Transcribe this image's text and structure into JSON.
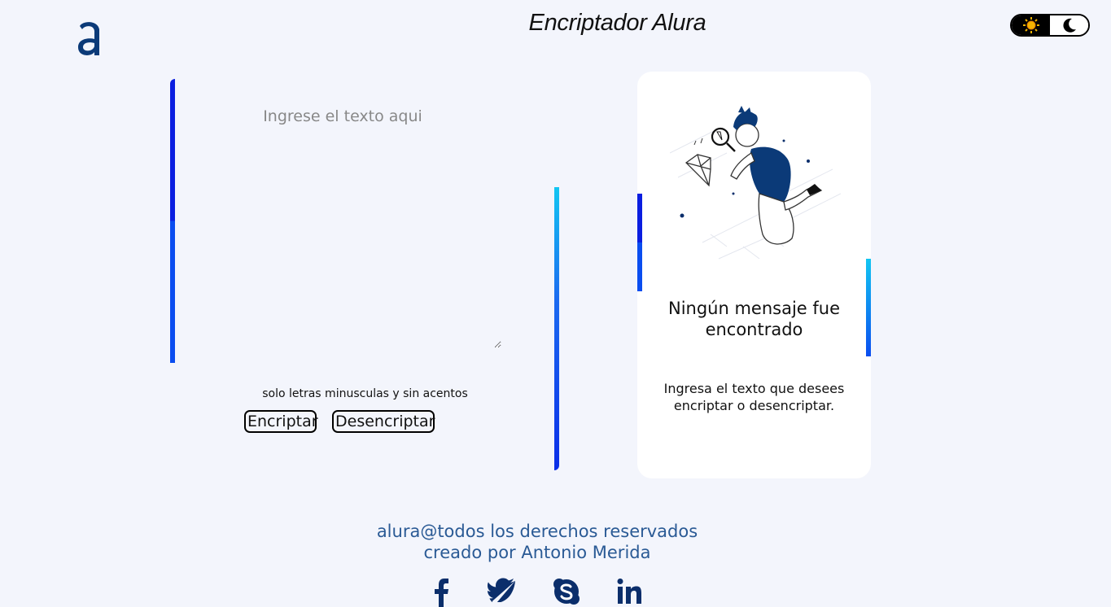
{
  "header": {
    "logo_icon": "alura-logo-icon",
    "title": "Encriptador Alura",
    "theme_toggle": {
      "light_icon": "sun-icon",
      "dark_icon": "moon-icon"
    }
  },
  "input": {
    "placeholder": "Ingrese el texto aqui",
    "value": ""
  },
  "hint": "solo letras minusculas y sin acentos",
  "buttons": {
    "encrypt": "Encriptar",
    "decrypt": "Desencriptar"
  },
  "result_card": {
    "illustration": "search-person-illustration",
    "title": "Ningún mensaje fue encontrado",
    "text": "Ingresa el texto que desees encriptar o desencriptar."
  },
  "footer": {
    "line1": "alura@todos los derechos reservados",
    "line2": "creado por Antonio Merida",
    "social": [
      "facebook-icon",
      "twitter-icon",
      "skype-icon",
      "linkedin-icon"
    ]
  },
  "colors": {
    "background": "#f3f5fc",
    "accent_blue": "#0a2ee8",
    "accent_cyan": "#12c6f2",
    "footer_text": "#2a5a95",
    "social_icons": "#0b2e6b"
  }
}
